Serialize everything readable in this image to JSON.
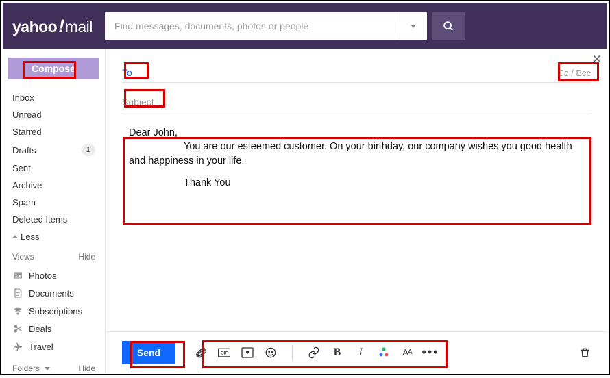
{
  "header": {
    "logo_a": "yahoo",
    "logo_b": "!",
    "logo_c": "mail",
    "search_placeholder": "Find messages, documents, photos or people"
  },
  "sidebar": {
    "compose": "Compose",
    "folders": [
      {
        "label": "Inbox"
      },
      {
        "label": "Unread"
      },
      {
        "label": "Starred"
      },
      {
        "label": "Drafts",
        "count": "1"
      },
      {
        "label": "Sent"
      },
      {
        "label": "Archive"
      },
      {
        "label": "Spam"
      },
      {
        "label": "Deleted Items"
      }
    ],
    "less": "Less",
    "views_header_left": "Views",
    "views_header_right": "Hide",
    "views": [
      {
        "label": "Photos",
        "icon": "image-icon"
      },
      {
        "label": "Documents",
        "icon": "document-icon"
      },
      {
        "label": "Subscriptions",
        "icon": "wifi-icon"
      },
      {
        "label": "Deals",
        "icon": "scissors-icon"
      },
      {
        "label": "Travel",
        "icon": "plane-icon"
      }
    ],
    "folders_header_left": "Folders",
    "folders_header_right": "Hide"
  },
  "compose_pane": {
    "to_label": "To",
    "ccbcc": "Cc / Bcc",
    "subject_placeholder": "Subject",
    "body_line1": "Dear John,",
    "body_line2": "You are our esteemed customer. On your birthday, our company wishes you good health and happiness in your life.",
    "body_line3": "Thank You",
    "send": "Send"
  }
}
